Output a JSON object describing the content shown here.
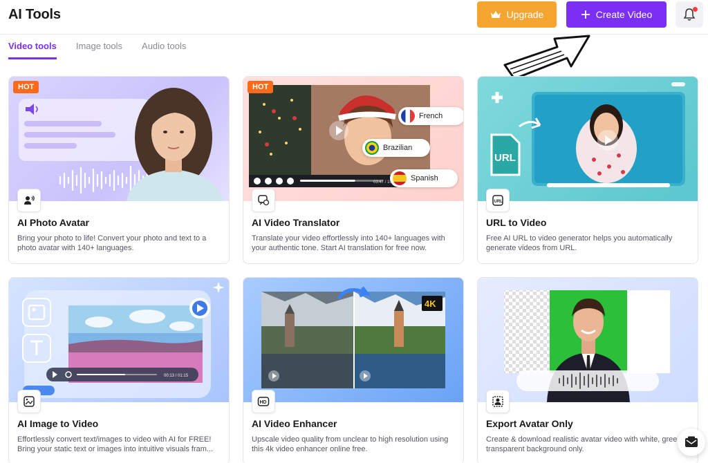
{
  "header": {
    "title": "AI Tools",
    "upgrade_label": "Upgrade",
    "create_label": "Create Video",
    "upgrade_color": "#f7a531",
    "create_color": "#7b2ff2"
  },
  "tabs": [
    {
      "label": "Video tools",
      "active": true
    },
    {
      "label": "Image tools",
      "active": false
    },
    {
      "label": "Audio tools",
      "active": false
    }
  ],
  "cards": [
    {
      "title": "AI Photo Avatar",
      "desc": "Bring your photo to life! Convert your photo and text to a photo avatar with 140+ languages.",
      "badge": "HOT",
      "icon": "avatar-speak-icon"
    },
    {
      "title": "AI Video Translator",
      "desc": "Translate your video effortlessly into 140+ languages with your authentic tone. Start AI translation for free now.",
      "badge": "HOT",
      "icon": "translate-icon"
    },
    {
      "title": "URL to Video",
      "desc": "Free AI URL to video generator helps you automatically generate videos from URL.",
      "icon": "url-icon"
    },
    {
      "title": "AI Image to Video",
      "desc": "Effortlessly convert text/images to video with AI for FREE! Bring your static text or images into intuitive visuals fram...",
      "icon": "image-video-icon"
    },
    {
      "title": "AI Video Enhancer",
      "desc": "Upscale video quality from unclear to high resolution using this 4k video enhancer online free.",
      "icon": "hd-icon"
    },
    {
      "title": "Export Avatar Only",
      "desc": "Create & download realistic avatar video with white, gree or transparent background only.",
      "icon": "avatar-export-icon"
    }
  ],
  "translator": {
    "langs": [
      "French",
      "Brazilian",
      "Spanish"
    ],
    "time": "03:47 / 10"
  },
  "image_to_video": {
    "time": "00:13 / 01:15"
  },
  "url_card_label": "URL",
  "enhancer_badge": "4K"
}
